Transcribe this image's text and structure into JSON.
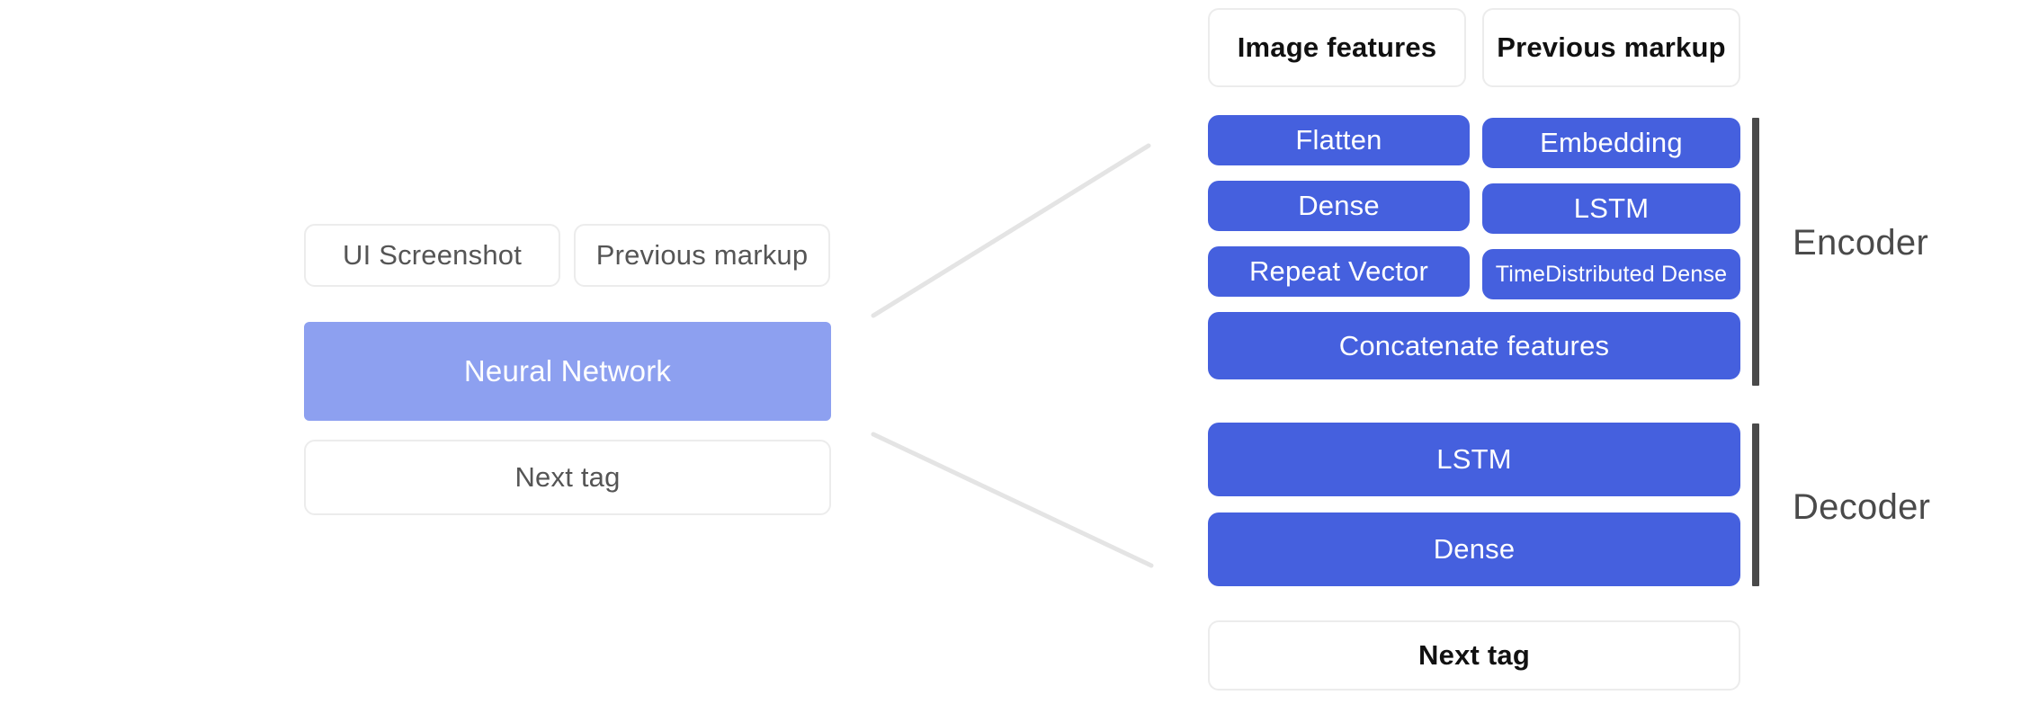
{
  "diagram": {
    "left_panel": {
      "inputs": [
        {
          "label": "UI Screenshot"
        },
        {
          "label": "Previous markup"
        }
      ],
      "model": {
        "label": "Neural Network"
      },
      "output": {
        "label": "Next tag"
      }
    },
    "right_panel": {
      "inputs": [
        {
          "label": "Image features"
        },
        {
          "label": "Previous markup"
        }
      ],
      "encoder": {
        "group_label": "Encoder",
        "column_left": [
          {
            "label": "Flatten"
          },
          {
            "label": "Dense"
          },
          {
            "label": "Repeat Vector"
          }
        ],
        "column_right": [
          {
            "label": "Embedding"
          },
          {
            "label": "LSTM"
          },
          {
            "label": "TimeDistributed Dense"
          }
        ],
        "merge": {
          "label": "Concatenate features"
        }
      },
      "decoder": {
        "group_label": "Decoder",
        "layers": [
          {
            "label": "LSTM"
          },
          {
            "label": "Dense"
          }
        ]
      },
      "output": {
        "label": "Next tag"
      }
    },
    "colors": {
      "layer_blue": "#4560DE",
      "model_light_blue": "#8DA0F0",
      "box_border": "#ECECEC",
      "connector_line": "#E4E4E4",
      "bracket": "#4A4A4A",
      "text_gray": "#555555",
      "text_dark": "#111111",
      "background": "#FFFFFF"
    }
  }
}
